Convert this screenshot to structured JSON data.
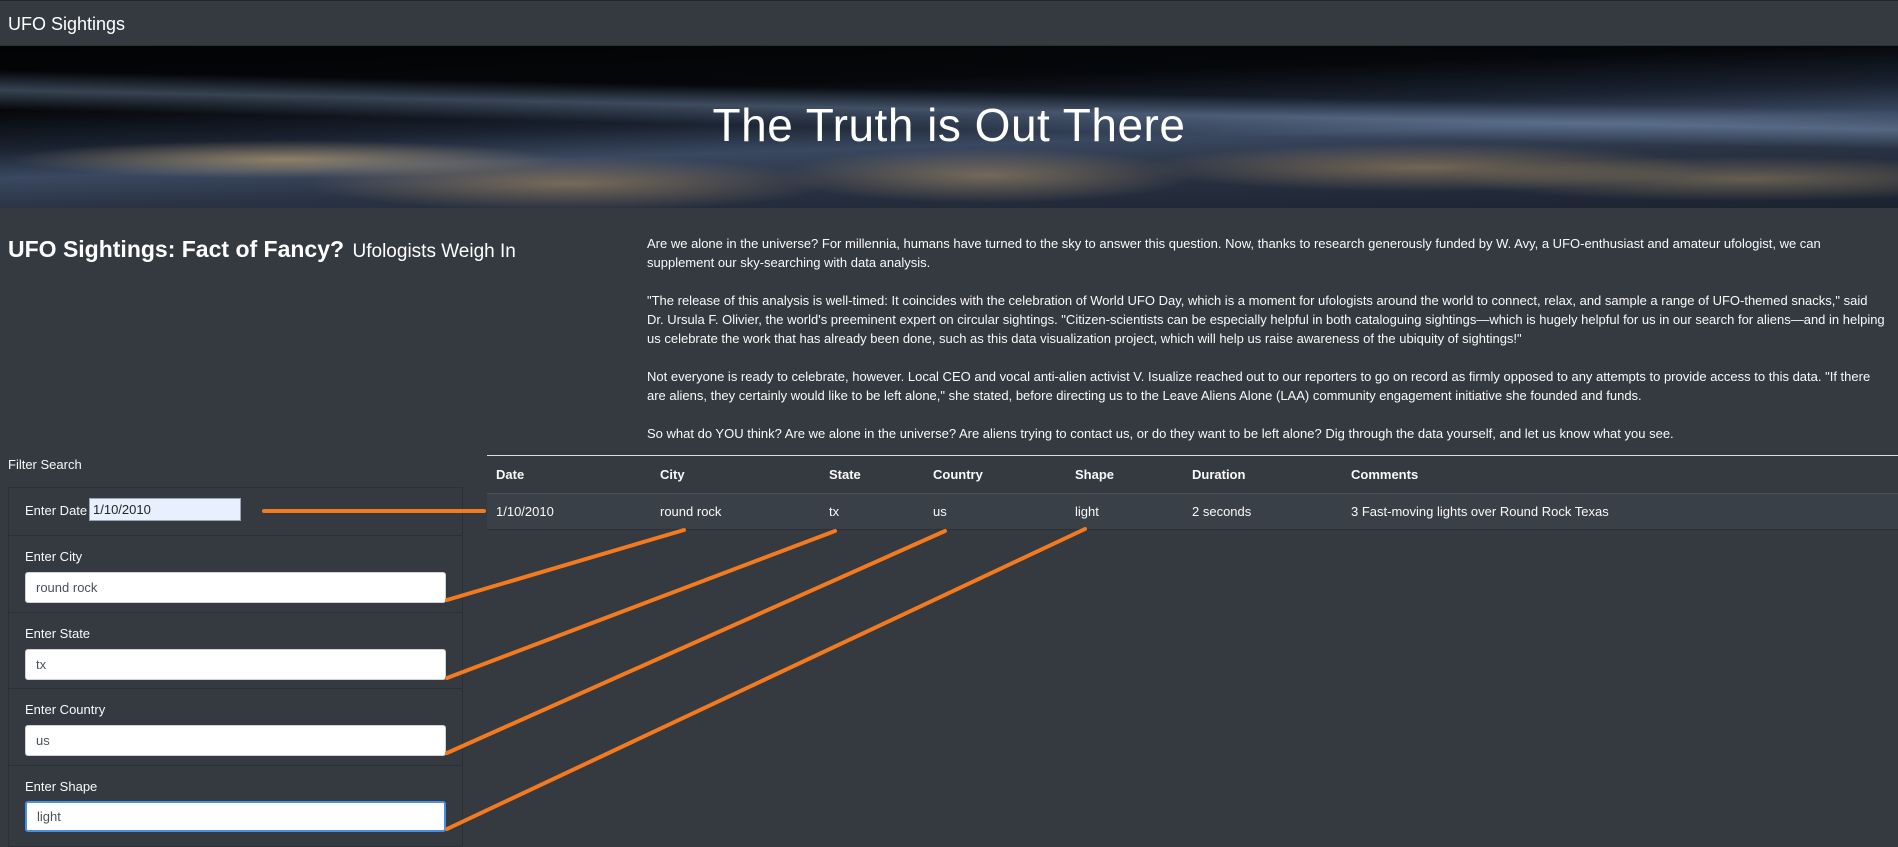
{
  "navbar": {
    "brand": "UFO Sightings"
  },
  "hero": {
    "title": "The Truth is Out There"
  },
  "headline": {
    "title": "UFO Sightings: Fact of Fancy?",
    "subtitle": "Ufologists Weigh In"
  },
  "article": {
    "paragraphs": [
      "Are we alone in the universe? For millennia, humans have turned to the sky to answer this question. Now, thanks to research generously funded by W. Avy, a UFO-enthusiast and amateur ufologist, we can supplement our sky-searching with data analysis.",
      "\"The release of this analysis is well-timed: It coincides with the celebration of World UFO Day, which is a moment for ufologists around the world to connect, relax, and sample a range of UFO-themed snacks,\" said Dr. Ursula F. Olivier, the world's preeminent expert on circular sightings. \"Citizen-scientists can be especially helpful in both cataloguing sightings—which is hugely helpful for us in our search for aliens—and in helping us celebrate the work that has already been done, such as this data visualization project, which will help us raise awareness of the ubiquity of sightings!\"",
      "Not everyone is ready to celebrate, however. Local CEO and vocal anti-alien activist V. Isualize reached out to our reporters to go on record as firmly opposed to any attempts to provide access to this data. \"If there are aliens, they certainly would like to be left alone,\" she stated, before directing us to the Leave Aliens Alone (LAA) community engagement initiative she founded and funds.",
      "So what do YOU think? Are we alone in the universe? Are aliens trying to contact us, or do they want to be left alone? Dig through the data yourself, and let us know what you see."
    ]
  },
  "filters": {
    "title": "Filter Search",
    "date": {
      "label": "Enter Date",
      "value": "1/10/2010"
    },
    "city": {
      "label": "Enter City",
      "value": "round rock"
    },
    "state": {
      "label": "Enter State",
      "value": "tx"
    },
    "country": {
      "label": "Enter Country",
      "value": "us"
    },
    "shape": {
      "label": "Enter Shape",
      "value": "light"
    }
  },
  "table": {
    "headers": [
      "Date",
      "City",
      "State",
      "Country",
      "Shape",
      "Duration",
      "Comments"
    ],
    "rows": [
      [
        "1/10/2010",
        "round rock",
        "tx",
        "us",
        "light",
        "2 seconds",
        "3 Fast-moving lights over Round Rock Texas"
      ]
    ]
  },
  "colors": {
    "background": "#343a40",
    "annotation": "#f47a20",
    "focus": "#4a90e2"
  }
}
